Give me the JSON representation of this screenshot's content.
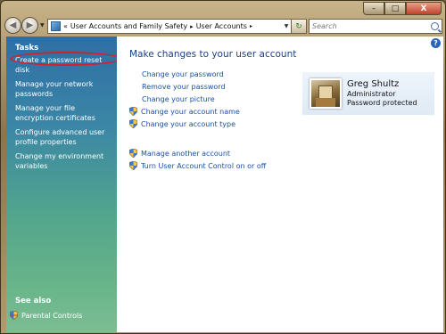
{
  "address": {
    "crumb1": "User Accounts and Family Safety",
    "crumb2": "User Accounts",
    "separator1": "«",
    "separator2": "▸"
  },
  "search": {
    "placeholder": "Search"
  },
  "window_controls": {
    "minimize": "–",
    "maximize": "□",
    "close": "X"
  },
  "left_pane": {
    "tasks_heading": "Tasks",
    "tasks": [
      "Create a password reset disk",
      "Manage your network passwords",
      "Manage your file encryption certificates",
      "Configure advanced user profile properties",
      "Change my environment variables"
    ],
    "see_also_heading": "See also",
    "see_also_items": [
      "Parental Controls"
    ]
  },
  "main": {
    "title": "Make changes to your user account",
    "links": [
      "Change your password",
      "Remove your password",
      "Change your picture",
      "Change your account name",
      "Change your account type"
    ],
    "other_links": [
      "Manage another account",
      "Turn User Account Control on or off"
    ],
    "help": "?"
  },
  "user": {
    "name": "Greg Shultz",
    "role": "Administrator",
    "status": "Password protected"
  },
  "colors": {
    "link": "#1a4fa8",
    "title": "#1c3f87",
    "highlight_circle": "#d4202a"
  }
}
